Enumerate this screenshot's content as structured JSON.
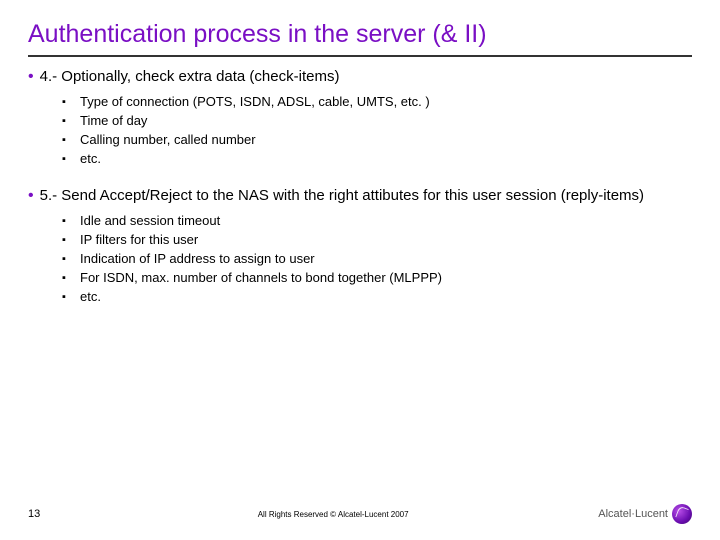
{
  "title": "Authentication process in the server (& II)",
  "sections": [
    {
      "head": "4.- Optionally, check extra data (check-items)",
      "items": [
        "Type of connection (POTS, ISDN, ADSL, cable, UMTS, etc. )",
        "Time of day",
        "Calling number, called number",
        "etc."
      ]
    },
    {
      "head": "5.- Send Accept/Reject to the NAS with the right attibutes for this user session (reply-items)",
      "items": [
        "Idle and session timeout",
        "IP filters for this user",
        "Indication of IP address to assign to user",
        "For ISDN, max. number of channels to bond together (MLPPP)",
        "etc."
      ]
    }
  ],
  "footer": {
    "page": "13",
    "copyright": "All Rights Reserved © Alcatel-Lucent 2007",
    "brand": "Alcatel·Lucent"
  }
}
